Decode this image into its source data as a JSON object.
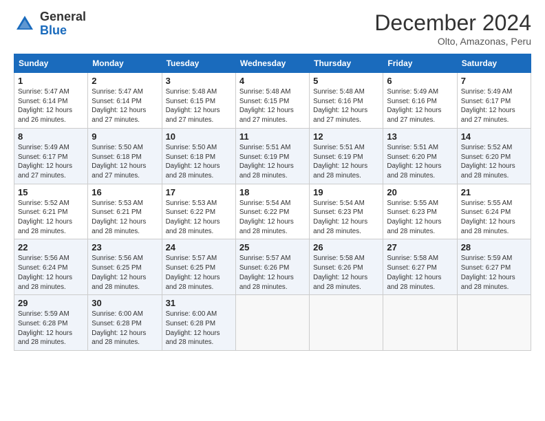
{
  "logo": {
    "general": "General",
    "blue": "Blue"
  },
  "header": {
    "title": "December 2024",
    "subtitle": "Olto, Amazonas, Peru"
  },
  "weekdays": [
    "Sunday",
    "Monday",
    "Tuesday",
    "Wednesday",
    "Thursday",
    "Friday",
    "Saturday"
  ],
  "weeks": [
    [
      {
        "day": "1",
        "sunrise": "5:47 AM",
        "sunset": "6:14 PM",
        "daylight": "12 hours and 26 minutes."
      },
      {
        "day": "2",
        "sunrise": "5:47 AM",
        "sunset": "6:14 PM",
        "daylight": "12 hours and 27 minutes."
      },
      {
        "day": "3",
        "sunrise": "5:48 AM",
        "sunset": "6:15 PM",
        "daylight": "12 hours and 27 minutes."
      },
      {
        "day": "4",
        "sunrise": "5:48 AM",
        "sunset": "6:15 PM",
        "daylight": "12 hours and 27 minutes."
      },
      {
        "day": "5",
        "sunrise": "5:48 AM",
        "sunset": "6:16 PM",
        "daylight": "12 hours and 27 minutes."
      },
      {
        "day": "6",
        "sunrise": "5:49 AM",
        "sunset": "6:16 PM",
        "daylight": "12 hours and 27 minutes."
      },
      {
        "day": "7",
        "sunrise": "5:49 AM",
        "sunset": "6:17 PM",
        "daylight": "12 hours and 27 minutes."
      }
    ],
    [
      {
        "day": "8",
        "sunrise": "5:49 AM",
        "sunset": "6:17 PM",
        "daylight": "12 hours and 27 minutes."
      },
      {
        "day": "9",
        "sunrise": "5:50 AM",
        "sunset": "6:18 PM",
        "daylight": "12 hours and 27 minutes."
      },
      {
        "day": "10",
        "sunrise": "5:50 AM",
        "sunset": "6:18 PM",
        "daylight": "12 hours and 28 minutes."
      },
      {
        "day": "11",
        "sunrise": "5:51 AM",
        "sunset": "6:19 PM",
        "daylight": "12 hours and 28 minutes."
      },
      {
        "day": "12",
        "sunrise": "5:51 AM",
        "sunset": "6:19 PM",
        "daylight": "12 hours and 28 minutes."
      },
      {
        "day": "13",
        "sunrise": "5:51 AM",
        "sunset": "6:20 PM",
        "daylight": "12 hours and 28 minutes."
      },
      {
        "day": "14",
        "sunrise": "5:52 AM",
        "sunset": "6:20 PM",
        "daylight": "12 hours and 28 minutes."
      }
    ],
    [
      {
        "day": "15",
        "sunrise": "5:52 AM",
        "sunset": "6:21 PM",
        "daylight": "12 hours and 28 minutes."
      },
      {
        "day": "16",
        "sunrise": "5:53 AM",
        "sunset": "6:21 PM",
        "daylight": "12 hours and 28 minutes."
      },
      {
        "day": "17",
        "sunrise": "5:53 AM",
        "sunset": "6:22 PM",
        "daylight": "12 hours and 28 minutes."
      },
      {
        "day": "18",
        "sunrise": "5:54 AM",
        "sunset": "6:22 PM",
        "daylight": "12 hours and 28 minutes."
      },
      {
        "day": "19",
        "sunrise": "5:54 AM",
        "sunset": "6:23 PM",
        "daylight": "12 hours and 28 minutes."
      },
      {
        "day": "20",
        "sunrise": "5:55 AM",
        "sunset": "6:23 PM",
        "daylight": "12 hours and 28 minutes."
      },
      {
        "day": "21",
        "sunrise": "5:55 AM",
        "sunset": "6:24 PM",
        "daylight": "12 hours and 28 minutes."
      }
    ],
    [
      {
        "day": "22",
        "sunrise": "5:56 AM",
        "sunset": "6:24 PM",
        "daylight": "12 hours and 28 minutes."
      },
      {
        "day": "23",
        "sunrise": "5:56 AM",
        "sunset": "6:25 PM",
        "daylight": "12 hours and 28 minutes."
      },
      {
        "day": "24",
        "sunrise": "5:57 AM",
        "sunset": "6:25 PM",
        "daylight": "12 hours and 28 minutes."
      },
      {
        "day": "25",
        "sunrise": "5:57 AM",
        "sunset": "6:26 PM",
        "daylight": "12 hours and 28 minutes."
      },
      {
        "day": "26",
        "sunrise": "5:58 AM",
        "sunset": "6:26 PM",
        "daylight": "12 hours and 28 minutes."
      },
      {
        "day": "27",
        "sunrise": "5:58 AM",
        "sunset": "6:27 PM",
        "daylight": "12 hours and 28 minutes."
      },
      {
        "day": "28",
        "sunrise": "5:59 AM",
        "sunset": "6:27 PM",
        "daylight": "12 hours and 28 minutes."
      }
    ],
    [
      {
        "day": "29",
        "sunrise": "5:59 AM",
        "sunset": "6:28 PM",
        "daylight": "12 hours and 28 minutes."
      },
      {
        "day": "30",
        "sunrise": "6:00 AM",
        "sunset": "6:28 PM",
        "daylight": "12 hours and 28 minutes."
      },
      {
        "day": "31",
        "sunrise": "6:00 AM",
        "sunset": "6:28 PM",
        "daylight": "12 hours and 28 minutes."
      },
      null,
      null,
      null,
      null
    ]
  ]
}
